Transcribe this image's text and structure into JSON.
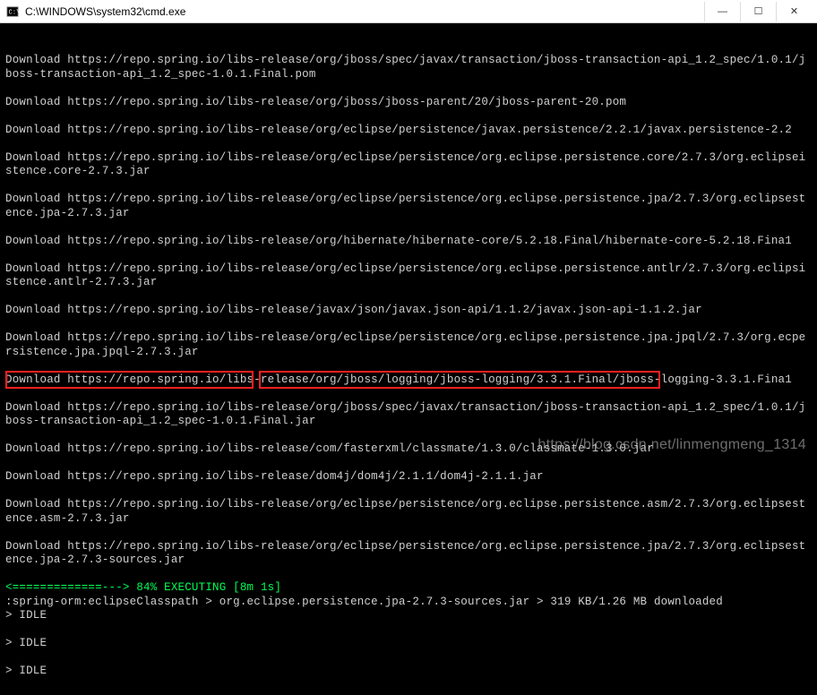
{
  "window": {
    "title": "C:\\WINDOWS\\system32\\cmd.exe"
  },
  "lines": [
    "",
    "Download https://repo.spring.io/libs-release/org/jboss/spec/javax/transaction/jboss-transaction-api_1.2_spec/1.0.1/jboss-transaction-api_1.2_spec-1.0.1.Final.pom",
    "Download https://repo.spring.io/libs-release/org/jboss/jboss-parent/20/jboss-parent-20.pom",
    "Download https://repo.spring.io/libs-release/org/eclipse/persistence/javax.persistence/2.2.1/javax.persistence-2.2",
    "Download https://repo.spring.io/libs-release/org/eclipse/persistence/org.eclipse.persistence.core/2.7.3/org.eclipseistence.core-2.7.3.jar",
    "Download https://repo.spring.io/libs-release/org/eclipse/persistence/org.eclipse.persistence.jpa/2.7.3/org.eclipsestence.jpa-2.7.3.jar",
    "Download https://repo.spring.io/libs-release/org/hibernate/hibernate-core/5.2.18.Final/hibernate-core-5.2.18.Fina1",
    "Download https://repo.spring.io/libs-release/org/eclipse/persistence/org.eclipse.persistence.antlr/2.7.3/org.eclipsistence.antlr-2.7.3.jar",
    "Download https://repo.spring.io/libs-release/javax/json/javax.json-api/1.1.2/javax.json-api-1.1.2.jar",
    "Download https://repo.spring.io/libs-release/org/eclipse/persistence/org.eclipse.persistence.jpa.jpql/2.7.3/org.ecpersistence.jpa.jpql-2.7.3.jar",
    "Download https://repo.spring.io/libs-release/org/jboss/logging/jboss-logging/3.3.1.Final/jboss-logging-3.3.1.Fina1",
    "Download https://repo.spring.io/libs-release/org/jboss/spec/javax/transaction/jboss-transaction-api_1.2_spec/1.0.1/jboss-transaction-api_1.2_spec-1.0.1.Final.jar",
    "Download https://repo.spring.io/libs-release/com/fasterxml/classmate/1.3.0/classmate-1.3.0.jar",
    "Download https://repo.spring.io/libs-release/dom4j/dom4j/2.1.1/dom4j-2.1.1.jar",
    "Download https://repo.spring.io/libs-release/org/eclipse/persistence/org.eclipse.persistence.asm/2.7.3/org.eclipsestence.asm-2.7.3.jar",
    "Download https://repo.spring.io/libs-release/org/eclipse/persistence/org.eclipse.persistence.jpa/2.7.3/org.eclipsestence.jpa-2.7.3-sources.jar"
  ],
  "progress": {
    "bar": "<=============---> 84% EXECUTING [8m 1s]",
    "task": ":spring-orm:eclipseClasspath",
    "sep1": " > ",
    "file": "org.eclipse.persistence.jpa-2.7.3-sources.jar",
    "sep2": " > ",
    "status": "319 KB/1.26 MB downloaded"
  },
  "idle": [
    "> IDLE",
    "> IDLE",
    "> IDLE"
  ],
  "watermark": "https://blog.csdn.net/linmengmeng_1314"
}
